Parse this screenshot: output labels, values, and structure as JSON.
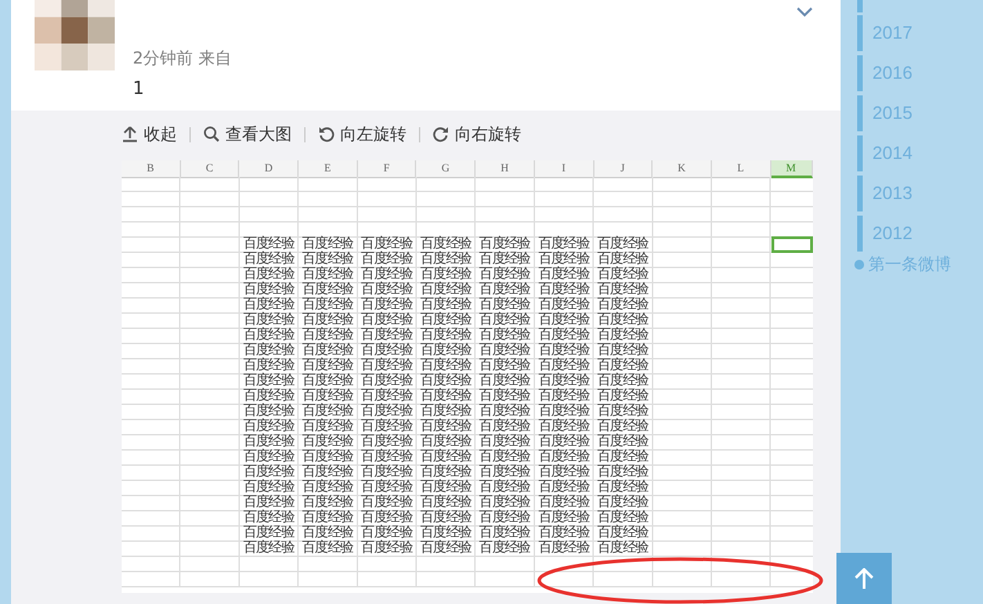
{
  "post": {
    "time": "2分钟前 来自",
    "text": "1"
  },
  "toolbar": [
    {
      "kind": "collapse",
      "label": "收起"
    },
    {
      "kind": "zoom",
      "label": "查看大图"
    },
    {
      "kind": "rotate_left",
      "label": "向左旋转"
    },
    {
      "kind": "rotate_right",
      "label": "向右旋转"
    }
  ],
  "sheet": {
    "columns": [
      {
        "label": "B",
        "selected": false
      },
      {
        "label": "C",
        "selected": false
      },
      {
        "label": "D",
        "selected": false
      },
      {
        "label": "E",
        "selected": false
      },
      {
        "label": "F",
        "selected": false
      },
      {
        "label": "G",
        "selected": false
      },
      {
        "label": "H",
        "selected": false
      },
      {
        "label": "I",
        "selected": false
      },
      {
        "label": "J",
        "selected": false
      },
      {
        "label": "K",
        "selected": false
      },
      {
        "label": "L",
        "selected": false
      },
      {
        "label": "M",
        "selected": true
      }
    ],
    "rows": [
      {
        "kind": "empty",
        "active": false
      },
      {
        "kind": "empty",
        "active": false
      },
      {
        "kind": "empty",
        "active": false
      },
      {
        "kind": "empty",
        "active": false
      },
      {
        "kind": "data",
        "active": true,
        "cells": [
          "百度经验",
          "百度经验",
          "百度经验",
          "百度经验",
          "百度经验",
          "百度经验",
          "百度经验"
        ]
      },
      {
        "kind": "data",
        "active": false,
        "cells": [
          "百度经验",
          "百度经验",
          "百度经验",
          "百度经验",
          "百度经验",
          "百度经验",
          "百度经验"
        ]
      },
      {
        "kind": "data",
        "active": false,
        "cells": [
          "百度经验",
          "百度经验",
          "百度经验",
          "百度经验",
          "百度经验",
          "百度经验",
          "百度经验"
        ]
      },
      {
        "kind": "data",
        "active": false,
        "cells": [
          "百度经验",
          "百度经验",
          "百度经验",
          "百度经验",
          "百度经验",
          "百度经验",
          "百度经验"
        ]
      },
      {
        "kind": "data",
        "active": false,
        "cells": [
          "百度经验",
          "百度经验",
          "百度经验",
          "百度经验",
          "百度经验",
          "百度经验",
          "百度经验"
        ]
      },
      {
        "kind": "data",
        "active": false,
        "cells": [
          "百度经验",
          "百度经验",
          "百度经验",
          "百度经验",
          "百度经验",
          "百度经验",
          "百度经验"
        ]
      },
      {
        "kind": "data",
        "active": false,
        "cells": [
          "百度经验",
          "百度经验",
          "百度经验",
          "百度经验",
          "百度经验",
          "百度经验",
          "百度经验"
        ]
      },
      {
        "kind": "data",
        "active": false,
        "cells": [
          "百度经验",
          "百度经验",
          "百度经验",
          "百度经验",
          "百度经验",
          "百度经验",
          "百度经验"
        ]
      },
      {
        "kind": "data",
        "active": false,
        "cells": [
          "百度经验",
          "百度经验",
          "百度经验",
          "百度经验",
          "百度经验",
          "百度经验",
          "百度经验"
        ]
      },
      {
        "kind": "data",
        "active": false,
        "cells": [
          "百度经验",
          "百度经验",
          "百度经验",
          "百度经验",
          "百度经验",
          "百度经验",
          "百度经验"
        ]
      },
      {
        "kind": "data",
        "active": false,
        "cells": [
          "百度经验",
          "百度经验",
          "百度经验",
          "百度经验",
          "百度经验",
          "百度经验",
          "百度经验"
        ]
      },
      {
        "kind": "data",
        "active": false,
        "cells": [
          "百度经验",
          "百度经验",
          "百度经验",
          "百度经验",
          "百度经验",
          "百度经验",
          "百度经验"
        ]
      },
      {
        "kind": "data",
        "active": false,
        "cells": [
          "百度经验",
          "百度经验",
          "百度经验",
          "百度经验",
          "百度经验",
          "百度经验",
          "百度经验"
        ]
      },
      {
        "kind": "data",
        "active": false,
        "cells": [
          "百度经验",
          "百度经验",
          "百度经验",
          "百度经验",
          "百度经验",
          "百度经验",
          "百度经验"
        ]
      },
      {
        "kind": "data",
        "active": false,
        "cells": [
          "百度经验",
          "百度经验",
          "百度经验",
          "百度经验",
          "百度经验",
          "百度经验",
          "百度经验"
        ]
      },
      {
        "kind": "data",
        "active": false,
        "cells": [
          "百度经验",
          "百度经验",
          "百度经验",
          "百度经验",
          "百度经验",
          "百度经验",
          "百度经验"
        ]
      },
      {
        "kind": "data",
        "active": false,
        "cells": [
          "百度经验",
          "百度经验",
          "百度经验",
          "百度经验",
          "百度经验",
          "百度经验",
          "百度经验"
        ]
      },
      {
        "kind": "data",
        "active": false,
        "cells": [
          "百度经验",
          "百度经验",
          "百度经验",
          "百度经验",
          "百度经验",
          "百度经验",
          "百度经验"
        ]
      },
      {
        "kind": "data",
        "active": false,
        "cells": [
          "百度经验",
          "百度经验",
          "百度经验",
          "百度经验",
          "百度经验",
          "百度经验",
          "百度经验"
        ]
      },
      {
        "kind": "data",
        "active": false,
        "cells": [
          "百度经验",
          "百度经验",
          "百度经验",
          "百度经验",
          "百度经验",
          "百度经验",
          "百度经验"
        ]
      },
      {
        "kind": "data",
        "active": false,
        "cells": [
          "百度经验",
          "百度经验",
          "百度经验",
          "百度经验",
          "百度经验",
          "百度经验",
          "百度经验"
        ]
      },
      {
        "kind": "empty",
        "active": false
      },
      {
        "kind": "empty",
        "active": false
      }
    ]
  },
  "annotation": {
    "kind": "ellipse"
  },
  "timeline": [
    {
      "kind": "year",
      "label": "2017"
    },
    {
      "kind": "year",
      "label": "2016"
    },
    {
      "kind": "year",
      "label": "2015"
    },
    {
      "kind": "year",
      "label": "2014"
    },
    {
      "kind": "year",
      "label": "2013"
    },
    {
      "kind": "year",
      "label": "2012"
    },
    {
      "kind": "first",
      "label": "第一条微博"
    }
  ]
}
